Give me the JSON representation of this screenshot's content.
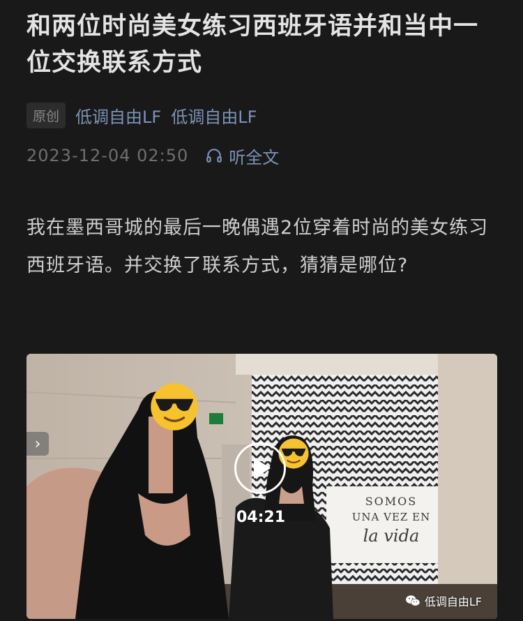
{
  "article": {
    "title": "和两位时尚美女练习西班牙语并和当中一位交换联系方式",
    "original_tag": "原创",
    "author": "低调自由LF",
    "account": "低调自由LF",
    "date": "2023-12-04 02:50",
    "listen_label": "听全文",
    "body": "我在墨西哥城的最后一晚偶遇2位穿着时尚的美女练习西班牙语。并交换了联系方式，猜猜是哪位?"
  },
  "video": {
    "duration": "04:21",
    "watermark": "低调自由LF",
    "sign_line1": "SOMOS",
    "sign_line2": "UNA VEZ EN",
    "sign_line3": "la vida",
    "side_arrow": "›"
  },
  "colors": {
    "background": "#191919",
    "link": "#7c93b8",
    "meta": "#6f6f6f"
  },
  "icons": [
    "headphones-icon",
    "play-icon",
    "wechat-icon",
    "chevron-right-icon",
    "sunglasses-emoji"
  ]
}
